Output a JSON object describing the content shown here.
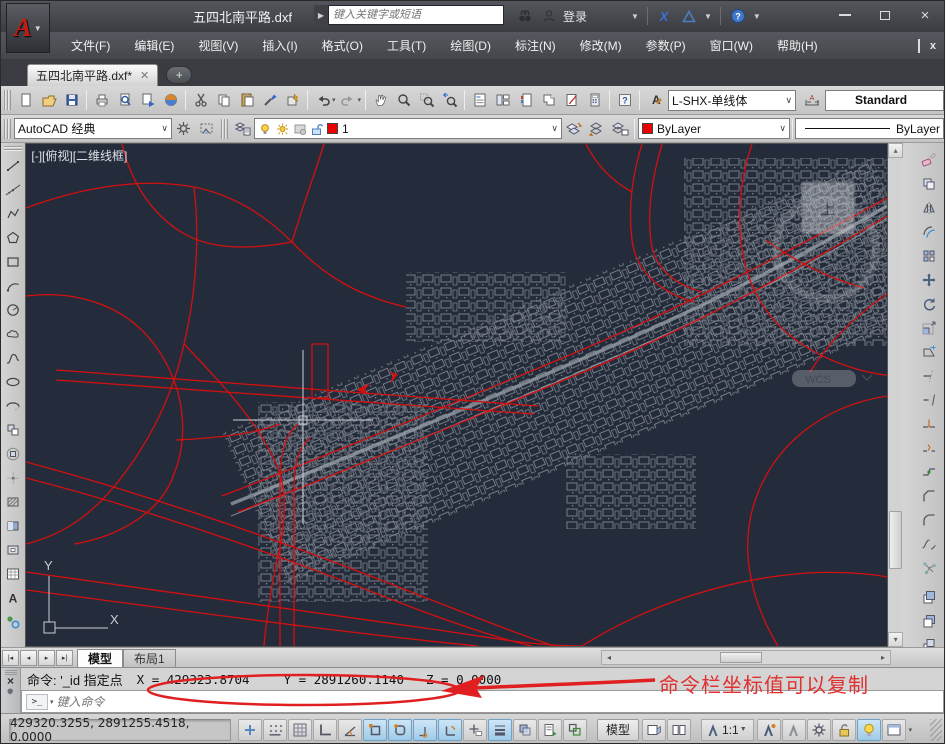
{
  "window": {
    "title": "五四北南平路.dxf"
  },
  "titlebar": {
    "search_placeholder": "键入关键字或短语",
    "signin": "登录",
    "icons": [
      "search-go",
      "binoculars",
      "user",
      "exchange",
      "a360",
      "help-circle"
    ]
  },
  "menubar": {
    "items": [
      "文件(F)",
      "编辑(E)",
      "视图(V)",
      "插入(I)",
      "格式(O)",
      "工具(T)",
      "绘图(D)",
      "标注(N)",
      "修改(M)",
      "参数(P)",
      "窗口(W)",
      "帮助(H)"
    ]
  },
  "doc_tab": {
    "label": "五四北南平路.dxf*"
  },
  "toolbars": {
    "standard_groups": [
      [
        "new",
        "open",
        "save"
      ],
      [
        "plot",
        "preview",
        "publish",
        "plot3d"
      ],
      [
        "cut",
        "copy",
        "paste",
        "matchprop",
        "block-editor"
      ],
      [
        "undo",
        "redo"
      ],
      [
        "pan",
        "zoom-realtime",
        "zoom-window",
        "zoom-previous"
      ],
      [
        "properties",
        "designcenter",
        "tool-palettes",
        "sheetset",
        "markup",
        "quickcalc"
      ],
      [
        "help"
      ]
    ],
    "styles": {
      "text_style": "L-SHX-单线体",
      "dim_style": "Standard"
    },
    "workspace": {
      "value": "AutoCAD 经典"
    },
    "layers": {
      "current": "1",
      "icons": [
        "layer-manager"
      ],
      "right_icons": [
        "make-layer-current",
        "layer-previous",
        "layer-states"
      ]
    },
    "properties": {
      "color": "ByLayer",
      "linetype": "ByLayer"
    }
  },
  "draw_toolbar": [
    "line",
    "construction-line",
    "polyline",
    "polygon",
    "rectangle",
    "arc",
    "circle",
    "revision-cloud",
    "spline",
    "ellipse",
    "ellipse-arc",
    "insert-block",
    "make-block",
    "point",
    "hatch",
    "gradient",
    "region",
    "table",
    "mtext",
    "add-selected"
  ],
  "modify_toolbar": [
    "erase",
    "copy-object",
    "mirror",
    "offset",
    "array",
    "move",
    "rotate",
    "scale",
    "stretch",
    "trim",
    "extend",
    "break-at-point",
    "break",
    "join",
    "chamfer",
    "fillet",
    "blend",
    "explode"
  ],
  "draworder_toolbar": [
    "bring-to-front",
    "send-to-back",
    "bring-above"
  ],
  "viewport": {
    "label": "[-][俯视][二维线框]",
    "viewcube_face": "上",
    "wcs_label": "WCS"
  },
  "ucs": {
    "x": "X",
    "y": "Y"
  },
  "layout_tabs": {
    "items": [
      "模型",
      "布局1"
    ],
    "active": "模型"
  },
  "command": {
    "echo": "命令: '_id 指定点",
    "coord_x": "X = 429323.8704",
    "coord_y": "Y = 2891260.1140",
    "coord_z": "Z = 0.0000",
    "placeholder": "键入命令",
    "annotation": "命令栏坐标值可以复制"
  },
  "statusbar": {
    "coordinates": "429320.3255, 2891255.4518, 0.0000",
    "toggles": [
      {
        "name": "infer-constraints",
        "on": false
      },
      {
        "name": "snap-mode",
        "on": false
      },
      {
        "name": "grid-display",
        "on": false
      },
      {
        "name": "ortho-mode",
        "on": false
      },
      {
        "name": "polar-tracking",
        "on": false
      },
      {
        "name": "object-snap",
        "on": true
      },
      {
        "name": "3d-object-snap",
        "on": true
      },
      {
        "name": "object-snap-tracking",
        "on": true
      },
      {
        "name": "dynamic-ucs",
        "on": true
      },
      {
        "name": "dynamic-input",
        "on": false
      },
      {
        "name": "show-lineweight",
        "on": true
      },
      {
        "name": "transparency",
        "on": false
      },
      {
        "name": "quick-properties",
        "on": false
      },
      {
        "name": "selection-cycling",
        "on": false
      }
    ],
    "model_button": "模型",
    "view_icons": [
      "quick-view-layouts",
      "quick-view-drawings"
    ],
    "annotation_scale": "1:1",
    "right_icons": [
      "annotation-visibility",
      "annotation-auto",
      "workspace-gear",
      "lock-unlocked",
      "isolate-objects",
      "clean-screen"
    ]
  },
  "colors": {
    "canvas_bg": "#242c3b",
    "road_red": "#d40f0f",
    "map_gray": "#8b919b",
    "accent_annotation": "#e03030",
    "layer_color": "#e00000"
  }
}
